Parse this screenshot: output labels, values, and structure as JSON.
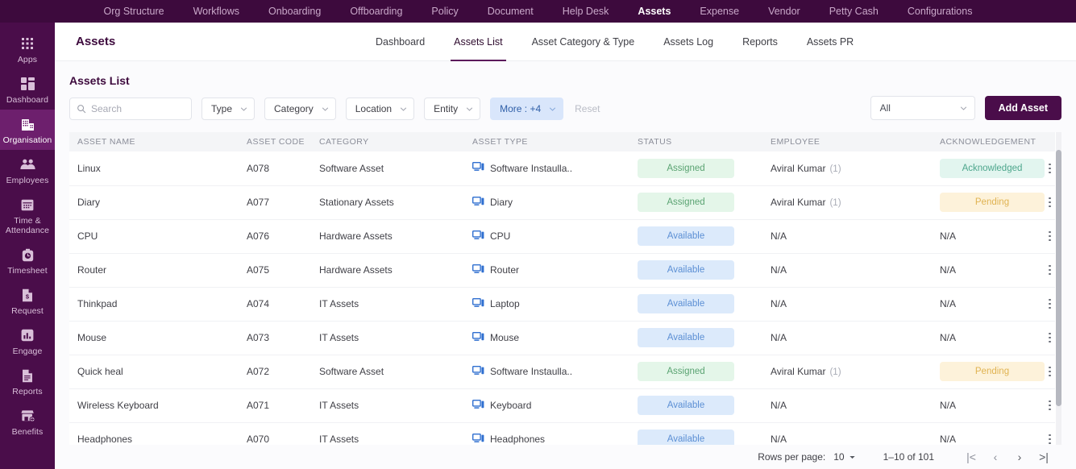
{
  "topnav": {
    "items": [
      {
        "label": "Org Structure",
        "active": false
      },
      {
        "label": "Workflows",
        "active": false
      },
      {
        "label": "Onboarding",
        "active": false
      },
      {
        "label": "Offboarding",
        "active": false
      },
      {
        "label": "Policy",
        "active": false
      },
      {
        "label": "Document",
        "active": false
      },
      {
        "label": "Help Desk",
        "active": false
      },
      {
        "label": "Assets",
        "active": true
      },
      {
        "label": "Expense",
        "active": false
      },
      {
        "label": "Vendor",
        "active": false
      },
      {
        "label": "Petty Cash",
        "active": false
      },
      {
        "label": "Configurations",
        "active": false
      }
    ]
  },
  "sidebar": {
    "items": [
      {
        "label": "Apps",
        "icon": "grid-apps-icon",
        "active": false
      },
      {
        "label": "Dashboard",
        "icon": "dashboard-icon",
        "active": false
      },
      {
        "label": "Organisation",
        "icon": "building-icon",
        "active": true
      },
      {
        "label": "Employees",
        "icon": "people-icon",
        "active": false
      },
      {
        "label": "Time & Attendance",
        "icon": "calendar-icon",
        "active": false
      },
      {
        "label": "Timesheet",
        "icon": "clock-bag-icon",
        "active": false
      },
      {
        "label": "Request",
        "icon": "money-document-icon",
        "active": false
      },
      {
        "label": "Engage",
        "icon": "bar-chart-icon",
        "active": false
      },
      {
        "label": "Reports",
        "icon": "document-icon",
        "active": false
      },
      {
        "label": "Benefits",
        "icon": "store-plus-icon",
        "active": false
      }
    ]
  },
  "header": {
    "title": "Assets",
    "subtabs": [
      {
        "label": "Dashboard",
        "active": false
      },
      {
        "label": "Assets List",
        "active": true
      },
      {
        "label": "Asset Category & Type",
        "active": false
      },
      {
        "label": "Assets Log",
        "active": false
      },
      {
        "label": "Reports",
        "active": false
      },
      {
        "label": "Assets PR",
        "active": false
      }
    ]
  },
  "content": {
    "list_title": "Assets List",
    "search": {
      "value": "",
      "placeholder": "Search"
    },
    "filters": [
      {
        "label": "Type"
      },
      {
        "label": "Category"
      },
      {
        "label": "Location"
      },
      {
        "label": "Entity"
      }
    ],
    "more_filter": {
      "label": "More : +4"
    },
    "reset_label": "Reset",
    "all_select": {
      "value": "All"
    },
    "add_button": {
      "label": "Add Asset"
    }
  },
  "table": {
    "columns": [
      "ASSET NAME",
      "ASSET CODE",
      "CATEGORY",
      "ASSET TYPE",
      "STATUS",
      "EMPLOYEE",
      "ACKNOWLEDGEMENT"
    ],
    "rows": [
      {
        "name": "Linux",
        "code": "A078",
        "category": "Software Asset",
        "type": "Software Instaulla..",
        "status": "Assigned",
        "status_kind": "assigned",
        "employee": "Aviral Kumar",
        "employee_count": "(1)",
        "ack": "Acknowledged",
        "ack_kind": "ack"
      },
      {
        "name": "Diary",
        "code": "A077",
        "category": "Stationary Assets",
        "type": "Diary",
        "status": "Assigned",
        "status_kind": "assigned",
        "employee": "Aviral Kumar",
        "employee_count": "(1)",
        "ack": "Pending",
        "ack_kind": "pending"
      },
      {
        "name": "CPU",
        "code": "A076",
        "category": "Hardware Assets",
        "type": "CPU",
        "status": "Available",
        "status_kind": "available",
        "employee": "N/A",
        "employee_count": "",
        "ack": "N/A",
        "ack_kind": "na"
      },
      {
        "name": "Router",
        "code": "A075",
        "category": "Hardware Assets",
        "type": "Router",
        "status": "Available",
        "status_kind": "available",
        "employee": "N/A",
        "employee_count": "",
        "ack": "N/A",
        "ack_kind": "na"
      },
      {
        "name": "Thinkpad",
        "code": "A074",
        "category": "IT Assets",
        "type": "Laptop",
        "status": "Available",
        "status_kind": "available",
        "employee": "N/A",
        "employee_count": "",
        "ack": "N/A",
        "ack_kind": "na"
      },
      {
        "name": "Mouse",
        "code": "A073",
        "category": "IT Assets",
        "type": "Mouse",
        "status": "Available",
        "status_kind": "available",
        "employee": "N/A",
        "employee_count": "",
        "ack": "N/A",
        "ack_kind": "na"
      },
      {
        "name": "Quick heal",
        "code": "A072",
        "category": "Software Asset",
        "type": "Software Instaulla..",
        "status": "Assigned",
        "status_kind": "assigned",
        "employee": "Aviral Kumar",
        "employee_count": "(1)",
        "ack": "Pending",
        "ack_kind": "pending"
      },
      {
        "name": "Wireless Keyboard",
        "code": "A071",
        "category": "IT Assets",
        "type": "Keyboard",
        "status": "Available",
        "status_kind": "available",
        "employee": "N/A",
        "employee_count": "",
        "ack": "N/A",
        "ack_kind": "na"
      },
      {
        "name": "Headphones",
        "code": "A070",
        "category": "IT Assets",
        "type": "Headphones",
        "status": "Available",
        "status_kind": "available",
        "employee": "N/A",
        "employee_count": "",
        "ack": "N/A",
        "ack_kind": "na"
      }
    ]
  },
  "pagination": {
    "rows_per_page_label": "Rows per page:",
    "rows_per_page_value": "10",
    "range": "1–10 of 101",
    "first_label": "|<",
    "prev_label": "‹",
    "next_label": "›",
    "last_label": ">|"
  },
  "colors": {
    "brand_purple": "#4a0d4a",
    "topbar_purple": "#3d0a3d",
    "accent_blue": "#2f5fa8",
    "status_assigned": "#5aa372",
    "status_available": "#5b8fd4",
    "ack_acknowledged": "#4da68c",
    "ack_pending": "#e0b352"
  }
}
